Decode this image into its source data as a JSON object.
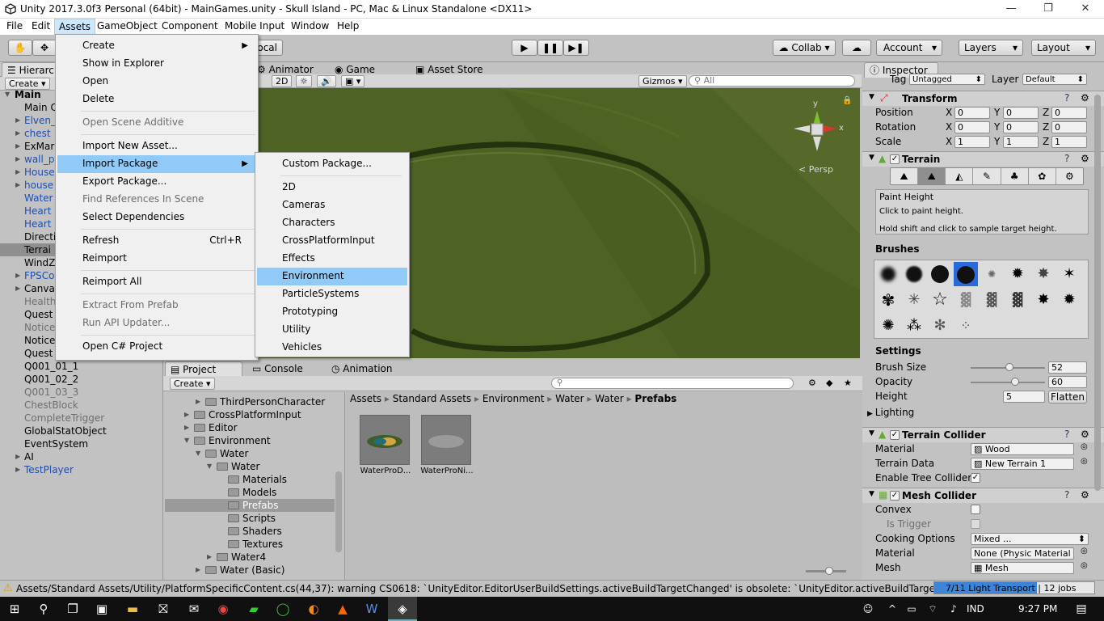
{
  "window": {
    "title": "Unity 2017.3.0f3 Personal (64bit) - MainGames.unity - Skull Island - PC, Mac & Linux Standalone <DX11>"
  },
  "menubar": [
    "File",
    "Edit",
    "Assets",
    "GameObject",
    "Component",
    "Mobile Input",
    "Window",
    "Help"
  ],
  "toolbar": {
    "pivot_partial": "ocal",
    "collab": "Collab ▾",
    "account": "Account",
    "layers": "Layers",
    "layout": "Layout"
  },
  "hierarchy": {
    "tab": "Hierarch",
    "create": "Create ▾",
    "rows": [
      {
        "label": "Main",
        "style": "bold",
        "arrow": "▼"
      },
      {
        "label": "Main C",
        "style": "normal",
        "arrow": ""
      },
      {
        "label": "Elven_",
        "style": "blue",
        "arrow": "▶"
      },
      {
        "label": "chest",
        "style": "blue",
        "arrow": "▶"
      },
      {
        "label": "ExMar",
        "style": "normal",
        "arrow": "▶"
      },
      {
        "label": "wall_p",
        "style": "blue",
        "arrow": "▶"
      },
      {
        "label": "House",
        "style": "blue",
        "arrow": "▶"
      },
      {
        "label": "house",
        "style": "blue",
        "arrow": "▶"
      },
      {
        "label": "Water",
        "style": "blue",
        "arrow": ""
      },
      {
        "label": "Heart",
        "style": "blue",
        "arrow": ""
      },
      {
        "label": "Heart",
        "style": "blue",
        "arrow": ""
      },
      {
        "label": "Directi",
        "style": "normal",
        "arrow": ""
      },
      {
        "label": "Terrai",
        "style": "selected",
        "arrow": ""
      },
      {
        "label": "WindZ",
        "style": "normal",
        "arrow": ""
      },
      {
        "label": "FPSCo",
        "style": "blue",
        "arrow": "▶"
      },
      {
        "label": "Canva",
        "style": "normal",
        "arrow": "▶"
      },
      {
        "label": "Health",
        "style": "grey",
        "arrow": ""
      },
      {
        "label": "Quest",
        "style": "normal",
        "arrow": ""
      },
      {
        "label": "Notice",
        "style": "grey",
        "arrow": ""
      },
      {
        "label": "Notice",
        "style": "normal",
        "arrow": ""
      },
      {
        "label": "Quest",
        "style": "normal",
        "arrow": ""
      },
      {
        "label": "Q001_01_1",
        "style": "normal",
        "arrow": ""
      },
      {
        "label": "Q001_02_2",
        "style": "normal",
        "arrow": ""
      },
      {
        "label": "Q001_03_3",
        "style": "grey",
        "arrow": ""
      },
      {
        "label": "ChestBlock",
        "style": "grey",
        "arrow": ""
      },
      {
        "label": "CompleteTrigger",
        "style": "grey",
        "arrow": ""
      },
      {
        "label": "GlobalStatObject",
        "style": "normal",
        "arrow": ""
      },
      {
        "label": "EventSystem",
        "style": "normal",
        "arrow": ""
      },
      {
        "label": "AI",
        "style": "normal",
        "arrow": "▶"
      },
      {
        "label": "TestPlayer",
        "style": "blue",
        "arrow": "▶"
      }
    ]
  },
  "assets_menu": {
    "items": [
      {
        "label": "Create",
        "submenu": true,
        "disabled": false,
        "shortcut": ""
      },
      {
        "label": "Show in Explorer",
        "submenu": false,
        "disabled": false,
        "shortcut": ""
      },
      {
        "label": "Open",
        "submenu": false,
        "disabled": false,
        "shortcut": ""
      },
      {
        "label": "Delete",
        "submenu": false,
        "disabled": false,
        "shortcut": ""
      },
      {
        "label": "Open Scene Additive",
        "submenu": false,
        "disabled": true,
        "shortcut": ""
      },
      {
        "label": "Import New Asset...",
        "submenu": false,
        "disabled": false,
        "shortcut": ""
      },
      {
        "label": "Import Package",
        "submenu": true,
        "disabled": false,
        "shortcut": "",
        "highlight": true
      },
      {
        "label": "Export Package...",
        "submenu": false,
        "disabled": false,
        "shortcut": ""
      },
      {
        "label": "Find References In Scene",
        "submenu": false,
        "disabled": true,
        "shortcut": ""
      },
      {
        "label": "Select Dependencies",
        "submenu": false,
        "disabled": false,
        "shortcut": ""
      },
      {
        "label": "Refresh",
        "submenu": false,
        "disabled": false,
        "shortcut": "Ctrl+R"
      },
      {
        "label": "Reimport",
        "submenu": false,
        "disabled": false,
        "shortcut": ""
      },
      {
        "label": "Reimport All",
        "submenu": false,
        "disabled": false,
        "shortcut": ""
      },
      {
        "label": "Extract From Prefab",
        "submenu": false,
        "disabled": true,
        "shortcut": ""
      },
      {
        "label": "Run API Updater...",
        "submenu": false,
        "disabled": true,
        "shortcut": ""
      },
      {
        "label": "Open C# Project",
        "submenu": false,
        "disabled": false,
        "shortcut": ""
      }
    ]
  },
  "import_package_menu": {
    "items": [
      "Custom Package...",
      "2D",
      "Cameras",
      "Characters",
      "CrossPlatformInput",
      "Effects",
      "Environment",
      "ParticleSystems",
      "Prototyping",
      "Utility",
      "Vehicles"
    ],
    "highlighted": "Environment"
  },
  "scene": {
    "tabs": [
      "Animator",
      "Game",
      "Asset Store"
    ],
    "mode_2d": "2D",
    "gizmos": "Gizmos ▾",
    "search_placeholder": "All",
    "persp": "Persp",
    "axes": {
      "y": "y",
      "x": "x"
    }
  },
  "project": {
    "tabs": [
      "Project",
      "Console",
      "Animation"
    ],
    "create": "Create ▾",
    "breadcrumb": [
      "Assets",
      "Standard Assets",
      "Environment",
      "Water",
      "Water",
      "Prefabs"
    ],
    "tree": [
      {
        "label": "ThirdPersonCharacter",
        "indent": 1,
        "arrow": "▶"
      },
      {
        "label": "CrossPlatformInput",
        "indent": 0,
        "arrow": "▶"
      },
      {
        "label": "Editor",
        "indent": 0,
        "arrow": "▶"
      },
      {
        "label": "Environment",
        "indent": 0,
        "arrow": "▼"
      },
      {
        "label": "Water",
        "indent": 1,
        "arrow": "▼"
      },
      {
        "label": "Water",
        "indent": 2,
        "arrow": "▼"
      },
      {
        "label": "Materials",
        "indent": 3,
        "arrow": ""
      },
      {
        "label": "Models",
        "indent": 3,
        "arrow": ""
      },
      {
        "label": "Prefabs",
        "indent": 3,
        "arrow": "",
        "selected": true
      },
      {
        "label": "Scripts",
        "indent": 3,
        "arrow": ""
      },
      {
        "label": "Shaders",
        "indent": 3,
        "arrow": ""
      },
      {
        "label": "Textures",
        "indent": 3,
        "arrow": ""
      },
      {
        "label": "Water4",
        "indent": 2,
        "arrow": "▶"
      },
      {
        "label": "Water (Basic)",
        "indent": 1,
        "arrow": "▶"
      }
    ],
    "assets": [
      "WaterProD...",
      "WaterProNi..."
    ]
  },
  "inspector": {
    "tab": "Inspector",
    "tag_label": "Tag",
    "tag_value": "Untagged",
    "layer_label": "Layer",
    "layer_value": "Default",
    "transform": {
      "title": "Transform",
      "rows": [
        {
          "label": "Position",
          "x": "0",
          "y": "0",
          "z": "0"
        },
        {
          "label": "Rotation",
          "x": "0",
          "y": "0",
          "z": "0"
        },
        {
          "label": "Scale",
          "x": "1",
          "y": "1",
          "z": "1"
        }
      ],
      "axis_letters": [
        "X",
        "Y",
        "Z"
      ]
    },
    "terrain": {
      "title": "Terrain",
      "tool_title": "Paint Height",
      "tool_desc1": "Click to paint height.",
      "tool_desc2": "Hold shift and click to sample target height.",
      "brushes_label": "Brushes",
      "settings_label": "Settings",
      "brush_size_label": "Brush Size",
      "brush_size": "52",
      "brush_size_frac": 0.52,
      "opacity_label": "Opacity",
      "opacity": "60",
      "opacity_frac": 0.6,
      "height_label": "Height",
      "height": "5",
      "flatten": "Flatten",
      "lighting": "Lighting"
    },
    "terrain_collider": {
      "title": "Terrain Collider",
      "material_label": "Material",
      "material": "Wood",
      "data_label": "Terrain Data",
      "data": "New Terrain 1",
      "tree_label": "Enable Tree Collider"
    },
    "mesh_collider": {
      "title": "Mesh Collider",
      "convex": "Convex",
      "trigger": "Is Trigger",
      "cooking_label": "Cooking Options",
      "cooking": "Mixed ...",
      "material_label": "Material",
      "material": "None (Physic Material",
      "mesh_label": "Mesh",
      "mesh": "Mesh"
    }
  },
  "status": {
    "message": "Assets/Standard Assets/Utility/PlatformSpecificContent.cs(44,37): warning CS0618: `UnityEditor.EditorUserBuildSettings.activeBuildTargetChanged' is obsolete: `UnityEditor.activeBuildTargetChange",
    "progress": "7/11 Light Transport | 12 jobs",
    "progress_frac": 0.64
  },
  "taskbar": {
    "lang": "IND",
    "time": "9:27 PM"
  },
  "colors": {
    "scene_green": "#4b5e22",
    "menu_highlight": "#91c9f7",
    "hierarchy_blue": "#1a4fb0"
  }
}
